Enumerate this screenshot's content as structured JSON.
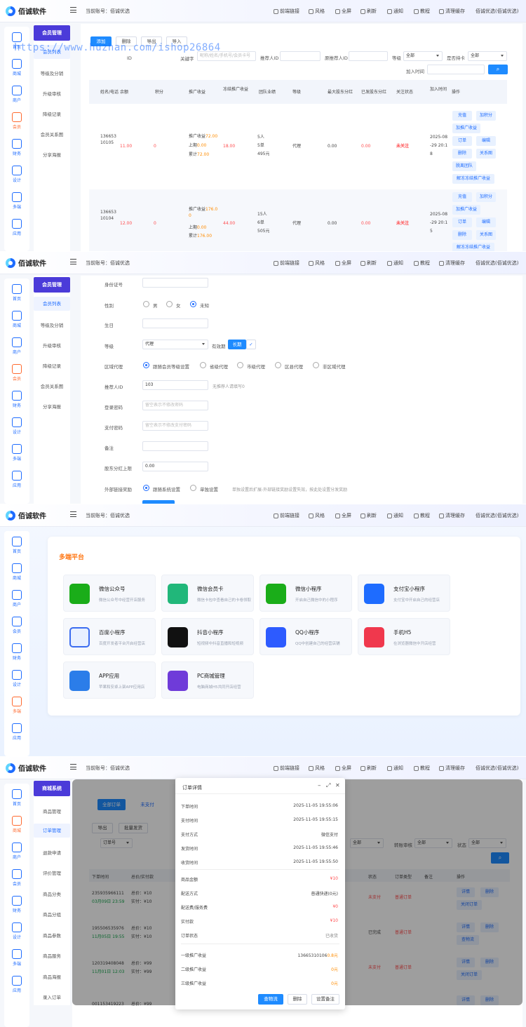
{
  "brand": "佰诚软件",
  "account": "当前账号：佰诚优选",
  "top_menu": [
    "前端链接",
    "风格",
    "全屏",
    "刷新",
    "通知",
    "教程",
    "清理缓存",
    "佰诚优选(佰诚优选)"
  ],
  "watermark": "https://www.huzhan.com/ishop26864",
  "sidebar": [
    "首页",
    "商城",
    "商户",
    "会员",
    "财务",
    "设计",
    "多端",
    "应用"
  ],
  "member_menu": {
    "title": "会员管理",
    "items": [
      "会员列表",
      "等级及分销",
      "升级审核",
      "降级记录",
      "会员关系图",
      "分享海报"
    ]
  },
  "panel1": {
    "buttons": [
      "添加",
      "删除",
      "导出",
      "导入"
    ],
    "filters": {
      "id": "ID",
      "keyword": "关键字",
      "keyword_ph": "昵称/姓名/手机号/会员卡号",
      "referrer_id": "推荐人ID",
      "orig_referrer_id": "原推荐人ID",
      "level": "等级",
      "level_val": "全部",
      "card": "是否持卡",
      "card_val": "全部",
      "join_time": "加入时间"
    },
    "headers": [
      "姓名/电话",
      "余额",
      "积分",
      "推广收益",
      "冻结推广收益",
      "团队业绩",
      "等级",
      "最大股东分红",
      "已发股东分红",
      "关注状态",
      "加入时间",
      "操作"
    ],
    "rows": [
      {
        "phone": "136653\n10105",
        "balance": "11.00",
        "points": "0",
        "promo_a": "推广收益",
        "promo_a_v": "72.00",
        "promo_b": "上期",
        "promo_b_v": "0.00",
        "promo_c": "累计",
        "promo_c_v": "72.00",
        "frozen": "18.00",
        "team": "5人\n5单\n495元",
        "level": "代理",
        "max_div": "0.00",
        "sent_div": "0.00",
        "follow": "未关注",
        "time": "2025-08\n-29 20:1\n8",
        "ops": [
          "充值",
          "加积分",
          "加推广收益",
          "订单",
          "编辑",
          "删除",
          "关系图",
          "脱离团队",
          "解冻冻结推广收益"
        ]
      },
      {
        "phone": "136653\n10104",
        "balance": "12.00",
        "points": "0",
        "promo_a": "推广收益",
        "promo_a_v": "176.0\n0",
        "promo_b": "上期",
        "promo_b_v": "0.00",
        "promo_c": "累计",
        "promo_c_v": "176.00",
        "frozen": "44.00",
        "team": "15人\n6单\n505元",
        "level": "代理",
        "max_div": "0.00",
        "sent_div": "0.00",
        "follow": "未关注",
        "time": "2025-08\n-29 20:1\n5",
        "ops": [
          "充值",
          "加积分",
          "加推广收益",
          "订单",
          "编辑",
          "删除",
          "关系图",
          "解冻冻结推广收益"
        ]
      }
    ]
  },
  "panel2": {
    "id_card": "身份证号",
    "gender": "性别",
    "gender_opts": [
      "男",
      "女",
      "未知"
    ],
    "birthday": "生日",
    "level": "等级",
    "level_val": "代理",
    "valid": "有效期",
    "valid_val": "长期",
    "region": "区域代理",
    "region_opts": [
      "跟随会员等级设置",
      "省级代理",
      "市级代理",
      "区县代理",
      "非区域代理"
    ],
    "referrer": "推荐人ID",
    "referrer_val": "103",
    "referrer_tip": "无推荐人请填写0",
    "login_pwd": "登录密码",
    "login_ph": "留空表示不修改密码",
    "pay_pwd": "支付密码",
    "pay_ph": "留空表示不修改支付密码",
    "remark": "备注",
    "div_cap": "股东分红上限",
    "div_val": "0.00",
    "ext": "外部链接奖励",
    "ext_opts": [
      "跟随系统设置",
      "单独设置"
    ],
    "ext_tip": "单独设置后扩展-外部链接奖励设置失效，按此处设置分发奖励"
  },
  "panel3": {
    "title": "多端平台",
    "cards": [
      {
        "name": "微信公众号",
        "desc": "微信公众号中经营开店服务",
        "color": "#1aad19"
      },
      {
        "name": "微信会员卡",
        "desc": "微信卡包中查看自己的卡卷领取",
        "color": "#21b77a"
      },
      {
        "name": "微信小程序",
        "desc": "开启自己微信中的小程序",
        "color": "#1aad19"
      },
      {
        "name": "支付宝小程序",
        "desc": "支付宝中开启自己的经营店",
        "color": "#1e6cff"
      },
      {
        "name": "百度小程序",
        "desc": "百度开发者平台开启经营店",
        "color": "#e8f0ff"
      },
      {
        "name": "抖音小程序",
        "desc": "短视频中抖音直播和短视频",
        "color": "#111111"
      },
      {
        "name": "QQ小程序",
        "desc": "QQ中创建自己的经营店铺",
        "color": "#2d5bff"
      },
      {
        "name": "手机H5",
        "desc": "在浏览器微信中开店经营",
        "color": "#f0384d"
      },
      {
        "name": "APP应用",
        "desc": "苹果和安卓上架APP应用店",
        "color": "#2b7de9"
      },
      {
        "name": "PC商城管理",
        "desc": "电脑商城H5共同开店经营",
        "color": "#6f3bd9"
      }
    ]
  },
  "panel4": {
    "mall_menu": {
      "title": "商城系统",
      "items": [
        "商品管理",
        "订单管理",
        "退款申请",
        "评价管理",
        "商品分类",
        "商品分组",
        "商品参数",
        "商品服务",
        "商品海报",
        "录入订单"
      ]
    },
    "tabs": [
      "全部订单",
      "未支付"
    ],
    "buttons": [
      "导出",
      "批量发货"
    ],
    "filters": {
      "order_no": "订单号",
      "all1": "全部",
      "transfer": "转账审核",
      "all2": "全部",
      "state": "状态",
      "all3": "全部"
    },
    "headers": [
      "下单时间",
      "总价/实付款",
      "状态",
      "订单类型",
      "备注",
      "操作"
    ],
    "rows": [
      {
        "no": "235935966111",
        "date": "03月09日 23:59",
        "total": "总价：¥10",
        "paid": "实付：¥10",
        "status": "未支付",
        "type": "普通订单",
        "ops": [
          "详情",
          "删除",
          "关闭订单"
        ]
      },
      {
        "no": "195506535976",
        "date": "11月05日 19:55",
        "total": "总价：¥10",
        "paid": "实付：¥10",
        "status": "已完成",
        "type": "普通订单",
        "ops": [
          "详情",
          "删除",
          "查物流"
        ]
      },
      {
        "no": "120319408048",
        "date": "11月01日 12:03",
        "total": "总价：¥99",
        "paid": "实付：¥99",
        "status": "未支付",
        "type": "普通订单",
        "ops": [
          "详情",
          "删除",
          "关闭订单"
        ]
      },
      {
        "no": "001153419223",
        "date": "",
        "total": "总价：¥99",
        "paid": "",
        "status": "",
        "type": "",
        "ops": [
          "详情",
          "删除"
        ]
      }
    ],
    "modal": {
      "title": "订单详情",
      "rows1": [
        [
          "下单时间",
          "2025-11-05 19:55:06"
        ],
        [
          "支付时间",
          "2025-11-05 19:55:15"
        ],
        [
          "支付方式",
          "微信支付"
        ],
        [
          "发货时间",
          "2025-11-05 19:55:46"
        ],
        [
          "收货时间",
          "2025-11-05 19:55:50"
        ]
      ],
      "rows2": [
        [
          "商品金额",
          "¥10"
        ],
        [
          "配送方式",
          "普通快递(0元)"
        ],
        [
          "配送费/服务费",
          "¥0"
        ],
        [
          "实付款",
          "¥10"
        ],
        [
          "订单状态",
          "已收货"
        ]
      ],
      "rows3": [
        [
          "一级推广收益",
          "13665310106",
          "0.8元"
        ],
        [
          "二级推广收益",
          "",
          "0元"
        ],
        [
          "三级推广收益",
          "",
          "0元"
        ]
      ],
      "buttons": [
        "查物流",
        "删除",
        "设置备注"
      ]
    }
  }
}
